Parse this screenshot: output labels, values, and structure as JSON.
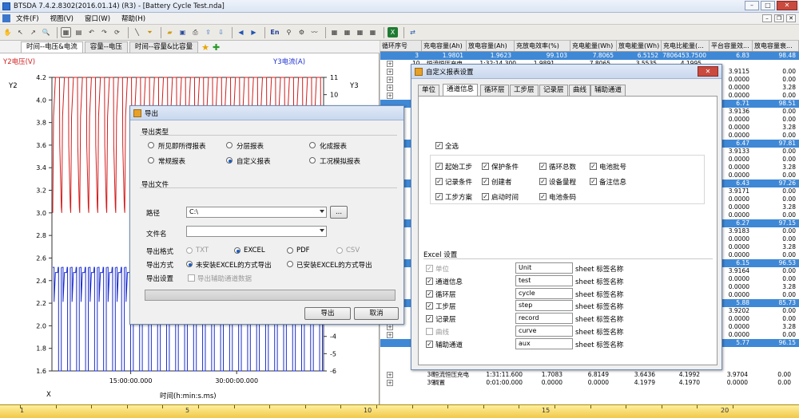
{
  "titlebar": {
    "title": "BTSDA 7.4.2.8302(2016.01.14) (R3) - [Battery Cycle Test.nda]"
  },
  "menubar": {
    "items": [
      "文件(F)",
      "视图(V)",
      "窗口(W)",
      "帮助(H)"
    ]
  },
  "toolbar": {
    "en_label": "En"
  },
  "tabs": [
    "时间--电压&电流",
    "容量--电压",
    "时间--容量&比容量"
  ],
  "chart": {
    "y2_title": "Y2电压(V)",
    "y3_title": "Y3电流(A)",
    "y2_axis_label": "Y2",
    "y3_axis_label": "Y3",
    "x_axis_label": "X",
    "x_title": "时间(h:min:s.ms)",
    "y2_ticks": [
      "4.2",
      "4.0",
      "3.8",
      "3.6",
      "3.4",
      "3.2",
      "3.0",
      "2.8",
      "2.6",
      "2.4",
      "2.2",
      "2.0",
      "1.8",
      "1.6"
    ],
    "y3_ticks": [
      "11",
      "10",
      "9",
      "8",
      "7",
      "6",
      "5",
      "4",
      "3",
      "2",
      "1",
      "0",
      "-1",
      "-2",
      "-3",
      "-4",
      "-5",
      "-6"
    ],
    "x_ticks": [
      "15:00:00.000",
      "30:00:00.000"
    ]
  },
  "chart_data": {
    "type": "line",
    "title": "",
    "xlabel": "时间(h:min:s.ms)",
    "ylabel": "电压(V)",
    "y2lim": [
      1.6,
      4.2
    ],
    "y3lim": [
      -6,
      11
    ],
    "series": [
      {
        "name": "Y2电压(V)",
        "color": "#d21e1e",
        "axis": "y2",
        "cycles": 30,
        "high": 4.2,
        "low": 3.0
      },
      {
        "name": "Y3电流(A)",
        "color": "#1c2fd0",
        "axis": "y3",
        "cycles": 30,
        "high": 0,
        "low": -6
      }
    ]
  },
  "grid": {
    "headers": [
      "循环序号",
      "充电容量(Ah)",
      "放电容量(Ah)",
      "充放电效率(%)",
      "充电能量(Wh)",
      "放电能量(Wh)",
      "充电比能量(...",
      "平台容量效...",
      "放电容量衰..."
    ],
    "first_row": [
      "3",
      "1.9801",
      "1.9623",
      "99.103",
      "7.8065",
      "6.5152",
      "7806453.7500",
      "6.83",
      "98.48"
    ],
    "second_row": [
      "10",
      "恒流恒压充电",
      "1:32:14.300",
      "1.9891",
      "7.8065",
      "3.5535",
      "4.1995"
    ],
    "right_values": [
      [
        "3.9115",
        "0.00"
      ],
      [
        "0.0000",
        "0.00"
      ],
      [
        "0.0000",
        "3.28"
      ],
      [
        "0.0000",
        "0.00"
      ],
      [
        "6.71",
        "98.51"
      ],
      [
        "3.9136",
        "0.00"
      ],
      [
        "0.0000",
        "0.00"
      ],
      [
        "0.0000",
        "3.28"
      ],
      [
        "0.0000",
        "0.00"
      ],
      [
        "6.47",
        "97.81"
      ],
      [
        "3.9133",
        "0.00"
      ],
      [
        "0.0000",
        "0.00"
      ],
      [
        "0.0000",
        "3.28"
      ],
      [
        "0.0000",
        "0.00"
      ],
      [
        "6.43",
        "97.26"
      ],
      [
        "3.9171",
        "0.00"
      ],
      [
        "0.0000",
        "0.00"
      ],
      [
        "0.0000",
        "3.28"
      ],
      [
        "0.0000",
        "0.00"
      ],
      [
        "6.27",
        "97.15"
      ],
      [
        "3.9183",
        "0.00"
      ],
      [
        "0.0000",
        "0.00"
      ],
      [
        "0.0000",
        "3.28"
      ],
      [
        "0.0000",
        "0.00"
      ],
      [
        "6.15",
        "96.53"
      ],
      [
        "3.9164",
        "0.00"
      ],
      [
        "0.0000",
        "0.00"
      ],
      [
        "0.0000",
        "3.28"
      ],
      [
        "0.0000",
        "0.00"
      ],
      [
        "5.88",
        "85.73"
      ],
      [
        "3.9202",
        "0.00"
      ],
      [
        "0.0000",
        "0.00"
      ],
      [
        "0.0000",
        "3.28"
      ],
      [
        "0.0000",
        "0.00"
      ],
      [
        "5.77",
        "96.15"
      ]
    ],
    "bottom_rows": [
      [
        "38",
        "恒流恒压充电",
        "1:31:11.600",
        "1.7083",
        "6.8149",
        "3.6436",
        "4.1992",
        "3.9704",
        "0.00"
      ],
      [
        "39",
        "搁置",
        "0:01:00.000",
        "0.0000",
        "0.0000",
        "4.1979",
        "4.1970",
        "0.0000",
        "0.00"
      ]
    ]
  },
  "ruler": {
    "numbers": [
      "1",
      "5",
      "10",
      "15",
      "20"
    ]
  },
  "export_dialog": {
    "title": "导出",
    "type_group": "导出类型",
    "types": [
      {
        "label": "所见即所得报表",
        "checked": false
      },
      {
        "label": "分层报表",
        "checked": false
      },
      {
        "label": "化成报表",
        "checked": false
      },
      {
        "label": "常规报表",
        "checked": false
      },
      {
        "label": "自定义报表",
        "checked": true
      },
      {
        "label": "工况模拟报表",
        "checked": false
      }
    ],
    "file_group": "导出文件",
    "path_label": "路径",
    "path_value": "C:\\",
    "browse_label": "...",
    "filename_label": "文件名",
    "filename_value": "",
    "format_label": "导出格式",
    "formats": [
      {
        "label": "TXT",
        "checked": false,
        "disabled": true
      },
      {
        "label": "EXCEL",
        "checked": true,
        "disabled": false
      },
      {
        "label": "PDF",
        "checked": false,
        "disabled": false
      },
      {
        "label": "CSV",
        "checked": false,
        "disabled": true
      }
    ],
    "method_label": "导出方式",
    "methods": [
      {
        "label": "未安装EXCEL的方式导出",
        "checked": true
      },
      {
        "label": "已安装EXCEL的方式导出",
        "checked": false
      }
    ],
    "setting_label": "导出设置",
    "aux_export_label": "导出辅助通道数据",
    "ok_label": "导出",
    "cancel_label": "取消"
  },
  "report_dialog": {
    "title": "自定义报表设置",
    "tabs": [
      "单位",
      "通道信息",
      "循环层",
      "工步层",
      "记录层",
      "曲线",
      "辅助通道"
    ],
    "active_tab": 1,
    "select_all": "全选",
    "fields": [
      [
        "起始工步",
        "保护条件",
        "循环总数",
        "电池批号"
      ],
      [
        "记录条件",
        "创建者",
        "设备量程",
        "备注信息"
      ],
      [
        "工步方案",
        "启动时间",
        "电池条码",
        ""
      ]
    ],
    "excel_group": "Excel 设置",
    "sheets": [
      {
        "label": "单位",
        "value": "Unit",
        "checked": true,
        "disabled": true
      },
      {
        "label": "通道信息",
        "value": "test",
        "checked": true,
        "disabled": false
      },
      {
        "label": "循环层",
        "value": "cycle",
        "checked": true,
        "disabled": false
      },
      {
        "label": "工步层",
        "value": "step",
        "checked": true,
        "disabled": false
      },
      {
        "label": "记录层",
        "value": "record",
        "checked": true,
        "disabled": false
      },
      {
        "label": "曲线",
        "value": "curve",
        "checked": false,
        "disabled": true
      },
      {
        "label": "辅助通道",
        "value": "aux",
        "checked": true,
        "disabled": false
      }
    ],
    "sheet_suffix": "sheet 标签名称"
  }
}
